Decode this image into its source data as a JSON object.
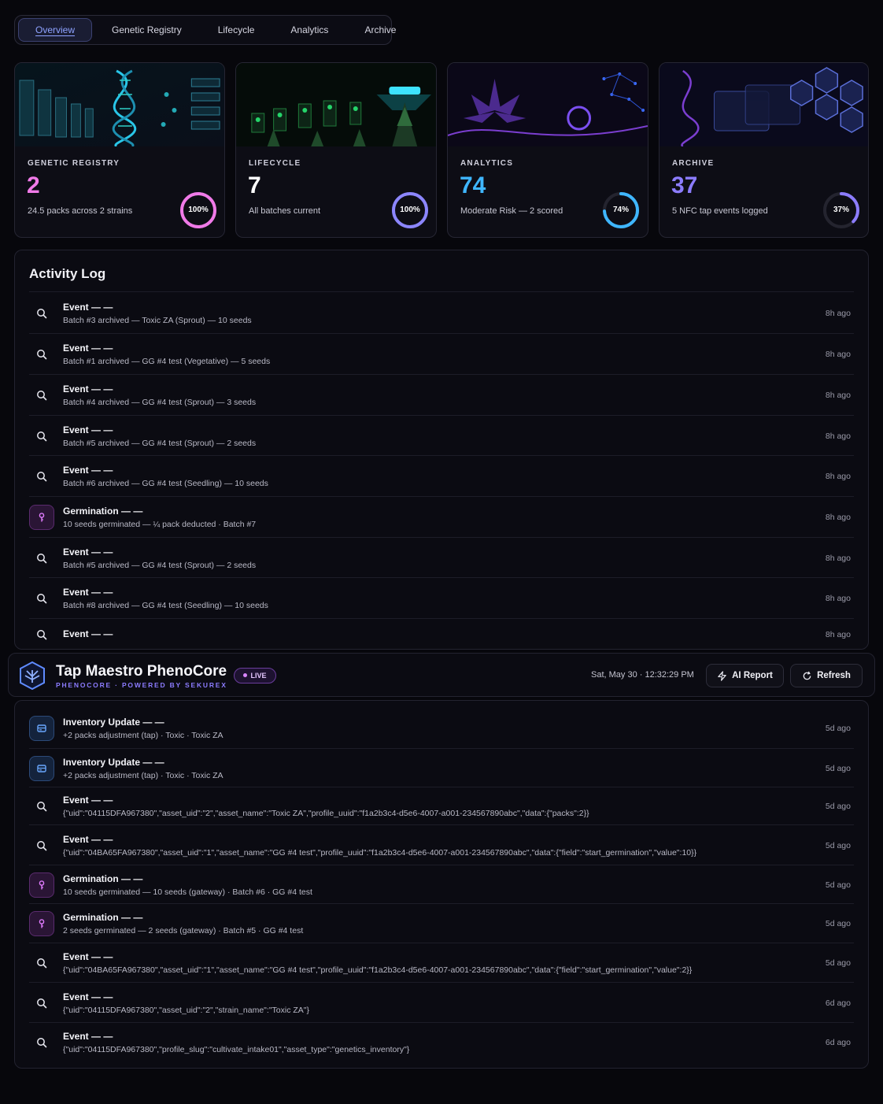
{
  "tabs": [
    {
      "label": "Overview",
      "active": true
    },
    {
      "label": "Genetic Registry",
      "active": false
    },
    {
      "label": "Lifecycle",
      "active": false
    },
    {
      "label": "Analytics",
      "active": false
    },
    {
      "label": "Archive",
      "active": false
    }
  ],
  "cards": [
    {
      "label": "GENETIC REGISTRY",
      "value": "2",
      "subtitle": "24.5 packs across 2 strains",
      "percent_label": "100%",
      "percent": 100,
      "color": "#f07ae8",
      "ring_color": "#f07ae8"
    },
    {
      "label": "LIFECYCLE",
      "value": "7",
      "subtitle": "All batches current",
      "percent_label": "100%",
      "percent": 100,
      "color": "#ffffff",
      "ring_color": "#8c86ff"
    },
    {
      "label": "ANALYTICS",
      "value": "74",
      "subtitle": "Moderate Risk — 2 scored",
      "percent_label": "74%",
      "percent": 74,
      "color": "#3fb6ff",
      "ring_color": "#3fb6ff"
    },
    {
      "label": "ARCHIVE",
      "value": "37",
      "subtitle": "5 NFC tap events logged",
      "percent_label": "37%",
      "percent": 37,
      "color": "#8c7cff",
      "ring_color": "#8c7cff"
    }
  ],
  "activity_log": {
    "title": "Activity Log",
    "items": [
      {
        "icon": "search-icon",
        "title": "Event — —",
        "detail": "Batch #3 archived — Toxic ZA (Sprout) — 10 seeds",
        "time": "8h ago"
      },
      {
        "icon": "search-icon",
        "title": "Event — —",
        "detail": "Batch #1 archived — GG #4 test (Vegetative) — 5 seeds",
        "time": "8h ago"
      },
      {
        "icon": "search-icon",
        "title": "Event — —",
        "detail": "Batch #4 archived — GG #4 test (Sprout) — 3 seeds",
        "time": "8h ago"
      },
      {
        "icon": "search-icon",
        "title": "Event — —",
        "detail": "Batch #5 archived — GG #4 test (Sprout) — 2 seeds",
        "time": "8h ago"
      },
      {
        "icon": "search-icon",
        "title": "Event — —",
        "detail": "Batch #6 archived — GG #4 test (Seedling) — 10 seeds",
        "time": "8h ago"
      },
      {
        "icon": "sprout-icon",
        "title": "Germination — —",
        "detail": "10 seeds germinated — ¼ pack deducted · Batch #7",
        "time": "8h ago"
      },
      {
        "icon": "search-icon",
        "title": "Event — —",
        "detail": "Batch #5 archived — GG #4 test (Sprout) — 2 seeds",
        "time": "8h ago"
      },
      {
        "icon": "search-icon",
        "title": "Event — —",
        "detail": "Batch #8 archived — GG #4 test (Seedling) — 10 seeds",
        "time": "8h ago"
      },
      {
        "icon": "search-icon",
        "title": "Event — —",
        "detail": "",
        "time": "8h ago"
      }
    ]
  },
  "header": {
    "title": "Tap Maestro PhenoCore",
    "subtitle": "PHENOCORE · POWERED BY SEKUREX",
    "live_label": "LIVE",
    "datetime": "Sat, May 30 · 12:32:29 PM",
    "ai_report_label": "AI Report",
    "refresh_label": "Refresh"
  },
  "feed": {
    "items": [
      {
        "icon": "inventory-icon",
        "title": "Inventory Update — —",
        "detail": "+2 packs adjustment (tap) · Toxic · Toxic ZA",
        "time": "5d ago"
      },
      {
        "icon": "inventory-icon",
        "title": "Inventory Update — —",
        "detail": "+2 packs adjustment (tap) · Toxic · Toxic ZA",
        "time": "5d ago"
      },
      {
        "icon": "search-icon",
        "title": "Event — —",
        "detail": "{\"uid\":\"04115DFA967380\",\"asset_uid\":\"2\",\"asset_name\":\"Toxic ZA\",\"profile_uuid\":\"f1a2b3c4-d5e6-4007-a001-234567890abc\",\"data\":{\"packs\":2}}",
        "time": "5d ago"
      },
      {
        "icon": "search-icon",
        "title": "Event — —",
        "detail": "{\"uid\":\"04BA65FA967380\",\"asset_uid\":\"1\",\"asset_name\":\"GG #4 test\",\"profile_uuid\":\"f1a2b3c4-d5e6-4007-a001-234567890abc\",\"data\":{\"field\":\"start_germination\",\"value\":10}}",
        "time": "5d ago"
      },
      {
        "icon": "sprout-icon",
        "title": "Germination — —",
        "detail": "10 seeds germinated — 10 seeds (gateway) · Batch #6 · GG #4 test",
        "time": "5d ago"
      },
      {
        "icon": "sprout-icon",
        "title": "Germination — —",
        "detail": "2 seeds germinated — 2 seeds (gateway) · Batch #5 · GG #4 test",
        "time": "5d ago"
      },
      {
        "icon": "search-icon",
        "title": "Event — —",
        "detail": "{\"uid\":\"04BA65FA967380\",\"asset_uid\":\"1\",\"asset_name\":\"GG #4 test\",\"profile_uuid\":\"f1a2b3c4-d5e6-4007-a001-234567890abc\",\"data\":{\"field\":\"start_germination\",\"value\":2}}",
        "time": "5d ago"
      },
      {
        "icon": "search-icon",
        "title": "Event — —",
        "detail": "{\"uid\":\"04115DFA967380\",\"asset_uid\":\"2\",\"strain_name\":\"Toxic ZA\"}",
        "time": "6d ago"
      },
      {
        "icon": "search-icon",
        "title": "Event — —",
        "detail": "{\"uid\":\"04115DFA967380\",\"profile_slug\":\"cultivate_intake01\",\"asset_type\":\"genetics_inventory\"}",
        "time": "6d ago"
      }
    ]
  }
}
